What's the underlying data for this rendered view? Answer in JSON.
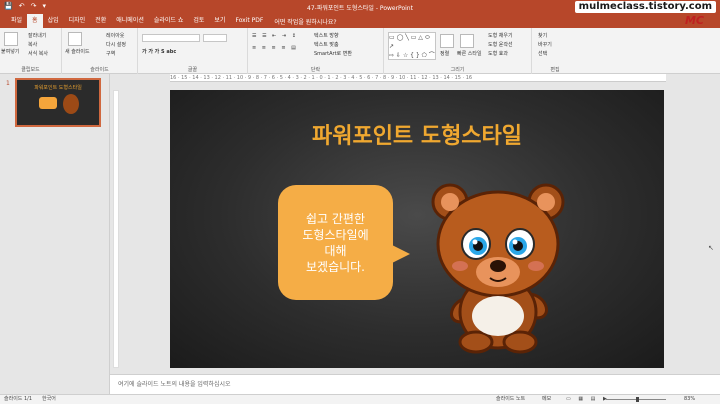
{
  "window": {
    "title": "47-파워포인트 도형스타일 - PowerPoint",
    "quick_access": [
      "💾",
      "↶",
      "↷",
      "▾"
    ]
  },
  "watermark": {
    "site": "mulmeclass.tistory.com",
    "logo": "MC"
  },
  "tabs": [
    "파일",
    "홈",
    "삽입",
    "디자인",
    "전환",
    "애니메이션",
    "슬라이드 쇼",
    "검토",
    "보기",
    "Foxit PDF"
  ],
  "active_tab": "홈",
  "tell_me": "어떤 작업을 원하시나요?",
  "ribbon": {
    "clipboard": {
      "label": "클립보드",
      "paste": "붙여넣기",
      "cut": "잘라내기",
      "copy": "복사",
      "format_painter": "서식 복사"
    },
    "slides": {
      "label": "슬라이드",
      "new_slide": "새 슬라이드",
      "layout": "레이아웃",
      "reset": "다시 설정",
      "section": "구역"
    },
    "font": {
      "label": "글꼴"
    },
    "paragraph": {
      "label": "단락",
      "text_direction": "텍스트 방향",
      "align_text": "텍스트 맞춤",
      "smartart": "SmartArt로 변환"
    },
    "drawing": {
      "label": "그리기",
      "arrange": "정렬",
      "quick_styles": "빠른 스타일",
      "fill": "도형 채우기",
      "outline": "도형 윤곽선",
      "effects": "도형 효과"
    },
    "editing": {
      "label": "편집",
      "find": "찾기",
      "replace": "바꾸기",
      "select": "선택"
    }
  },
  "thumbnails": [
    {
      "number": "1",
      "title": "파워포인트 도형스타일"
    }
  ],
  "ruler": "16 · 15 · 14 · 13 · 12 · 11 · 10 · 9 · 8 · 7 · 6 · 5 · 4 · 3 · 2 · 1 · 0 · 1 · 2 · 3 · 4 · 5 · 6 · 7 · 8 · 9 · 10 · 11 · 12 · 13 · 14 · 15 · 16",
  "slide": {
    "title": "파워포인트 도형스타일",
    "bubble_lines": [
      "쉽고 간편한",
      "도형스타일에",
      "대해",
      "보겠습니다."
    ]
  },
  "notes_placeholder": "여기에 슬라이드 노트의 내용을 입력하십시오",
  "status": {
    "slide": "슬라이드 1/1",
    "language": "한국어",
    "notes": "슬라이드 노트",
    "memo": "메모",
    "zoom": "83%"
  },
  "colors": {
    "accent": "#b7472a",
    "title": "#f0a830",
    "bubble": "#f5ad46"
  }
}
